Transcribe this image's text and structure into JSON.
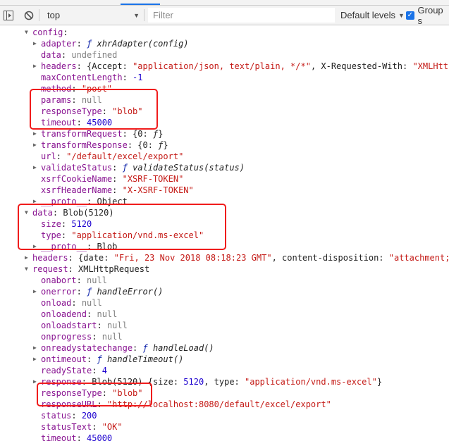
{
  "toolbar": {
    "context": "top",
    "filter_placeholder": "Filter",
    "levels": "Default levels",
    "group_label": "Group s",
    "group_checked": true
  },
  "colors": {
    "key": "#881391",
    "string": "#c41a16",
    "number": "#1c00cf",
    "null": "#808080",
    "highlight": "#f01c1c",
    "accent": "#1a73e8"
  },
  "rows": [
    {
      "level": 1,
      "arrow": "down",
      "key": "config",
      "tokens": []
    },
    {
      "level": 2,
      "arrow": "right",
      "key": "adapter",
      "tokens": [
        [
          "fk",
          "ƒ "
        ],
        [
          "fn",
          "xhrAdapter(config)"
        ]
      ]
    },
    {
      "level": 2,
      "arrow": "",
      "key": "data",
      "tokens": [
        [
          "nul",
          "undefined"
        ]
      ]
    },
    {
      "level": 2,
      "arrow": "right",
      "key": "headers",
      "tokens": [
        [
          "p",
          "{Accept: "
        ],
        [
          "str",
          "\"application/json, text/plain, */*\""
        ],
        [
          "p",
          ", X-Requested-With: "
        ],
        [
          "str",
          "\"XMLHttpRequest\""
        ],
        [
          "p",
          "}"
        ]
      ]
    },
    {
      "level": 2,
      "arrow": "",
      "key": "maxContentLength",
      "tokens": [
        [
          "num",
          "-1"
        ]
      ]
    },
    {
      "level": 2,
      "arrow": "",
      "key": "method",
      "tokens": [
        [
          "str",
          "\"post\""
        ]
      ]
    },
    {
      "level": 2,
      "arrow": "",
      "key": "params",
      "tokens": [
        [
          "nul",
          "null"
        ]
      ]
    },
    {
      "level": 2,
      "arrow": "",
      "key": "responseType",
      "tokens": [
        [
          "str",
          "\"blob\""
        ]
      ]
    },
    {
      "level": 2,
      "arrow": "",
      "key": "timeout",
      "tokens": [
        [
          "num",
          "45000"
        ]
      ]
    },
    {
      "level": 2,
      "arrow": "right",
      "key": "transformRequest",
      "tokens": [
        [
          "p",
          "{0: "
        ],
        [
          "fn",
          "ƒ"
        ],
        [
          "p",
          "}"
        ]
      ]
    },
    {
      "level": 2,
      "arrow": "right",
      "key": "transformResponse",
      "tokens": [
        [
          "p",
          "{0: "
        ],
        [
          "fn",
          "ƒ"
        ],
        [
          "p",
          "}"
        ]
      ]
    },
    {
      "level": 2,
      "arrow": "",
      "key": "url",
      "tokens": [
        [
          "str",
          "\"/default/excel/export\""
        ]
      ]
    },
    {
      "level": 2,
      "arrow": "right",
      "key": "validateStatus",
      "tokens": [
        [
          "fk",
          "ƒ "
        ],
        [
          "fn",
          "validateStatus(status)"
        ]
      ]
    },
    {
      "level": 2,
      "arrow": "",
      "key": "xsrfCookieName",
      "tokens": [
        [
          "str",
          "\"XSRF-TOKEN\""
        ]
      ]
    },
    {
      "level": 2,
      "arrow": "",
      "key": "xsrfHeaderName",
      "tokens": [
        [
          "str",
          "\"X-XSRF-TOKEN\""
        ]
      ]
    },
    {
      "level": 2,
      "arrow": "right",
      "key": "__proto__",
      "tokens": [
        [
          "p",
          "Object"
        ]
      ]
    },
    {
      "level": 1,
      "arrow": "down",
      "key": "data",
      "tokens": [
        [
          "p",
          "Blob(5120)"
        ]
      ]
    },
    {
      "level": 2,
      "arrow": "",
      "key": "size",
      "tokens": [
        [
          "num",
          "5120"
        ]
      ]
    },
    {
      "level": 2,
      "arrow": "",
      "key": "type",
      "tokens": [
        [
          "str",
          "\"application/vnd.ms-excel\""
        ]
      ]
    },
    {
      "level": 2,
      "arrow": "right",
      "key": "__proto__",
      "tokens": [
        [
          "p",
          "Blob"
        ]
      ]
    },
    {
      "level": 1,
      "arrow": "right",
      "key": "headers",
      "tokens": [
        [
          "p",
          "{date: "
        ],
        [
          "str",
          "\"Fri, 23 Nov 2018 08:18:23 GMT\""
        ],
        [
          "p",
          ", content-disposition: "
        ],
        [
          "str",
          "\"attachment;"
        ]
      ]
    },
    {
      "level": 1,
      "arrow": "down",
      "key": "request",
      "tokens": [
        [
          "p",
          "XMLHttpRequest"
        ]
      ]
    },
    {
      "level": 2,
      "arrow": "",
      "key": "onabort",
      "tokens": [
        [
          "nul",
          "null"
        ]
      ]
    },
    {
      "level": 2,
      "arrow": "right",
      "key": "onerror",
      "tokens": [
        [
          "fk",
          "ƒ "
        ],
        [
          "fn",
          "handleError()"
        ]
      ]
    },
    {
      "level": 2,
      "arrow": "",
      "key": "onload",
      "tokens": [
        [
          "nul",
          "null"
        ]
      ]
    },
    {
      "level": 2,
      "arrow": "",
      "key": "onloadend",
      "tokens": [
        [
          "nul",
          "null"
        ]
      ]
    },
    {
      "level": 2,
      "arrow": "",
      "key": "onloadstart",
      "tokens": [
        [
          "nul",
          "null"
        ]
      ]
    },
    {
      "level": 2,
      "arrow": "",
      "key": "onprogress",
      "tokens": [
        [
          "nul",
          "null"
        ]
      ]
    },
    {
      "level": 2,
      "arrow": "right",
      "key": "onreadystatechange",
      "tokens": [
        [
          "fk",
          "ƒ "
        ],
        [
          "fn",
          "handleLoad()"
        ]
      ]
    },
    {
      "level": 2,
      "arrow": "right",
      "key": "ontimeout",
      "tokens": [
        [
          "fk",
          "ƒ "
        ],
        [
          "fn",
          "handleTimeout()"
        ]
      ]
    },
    {
      "level": 2,
      "arrow": "",
      "key": "readyState",
      "tokens": [
        [
          "num",
          "4"
        ]
      ]
    },
    {
      "level": 2,
      "arrow": "right",
      "key": "response",
      "tokens": [
        [
          "p",
          "Blob(5120) {size: "
        ],
        [
          "num",
          "5120"
        ],
        [
          "p",
          ", type: "
        ],
        [
          "str",
          "\"application/vnd.ms-excel\""
        ],
        [
          "p",
          "}"
        ]
      ]
    },
    {
      "level": 2,
      "arrow": "",
      "key": "responseType",
      "tokens": [
        [
          "str",
          "\"blob\""
        ]
      ]
    },
    {
      "level": 2,
      "arrow": "",
      "key": "responseURL",
      "tokens": [
        [
          "str",
          "\"http://localhost:8080/default/excel/export\""
        ]
      ]
    },
    {
      "level": 2,
      "arrow": "",
      "key": "status",
      "tokens": [
        [
          "num",
          "200"
        ]
      ]
    },
    {
      "level": 2,
      "arrow": "",
      "key": "statusText",
      "tokens": [
        [
          "str",
          "\"OK\""
        ]
      ]
    },
    {
      "level": 2,
      "arrow": "",
      "key": "timeout",
      "tokens": [
        [
          "num",
          "45000"
        ]
      ]
    }
  ]
}
